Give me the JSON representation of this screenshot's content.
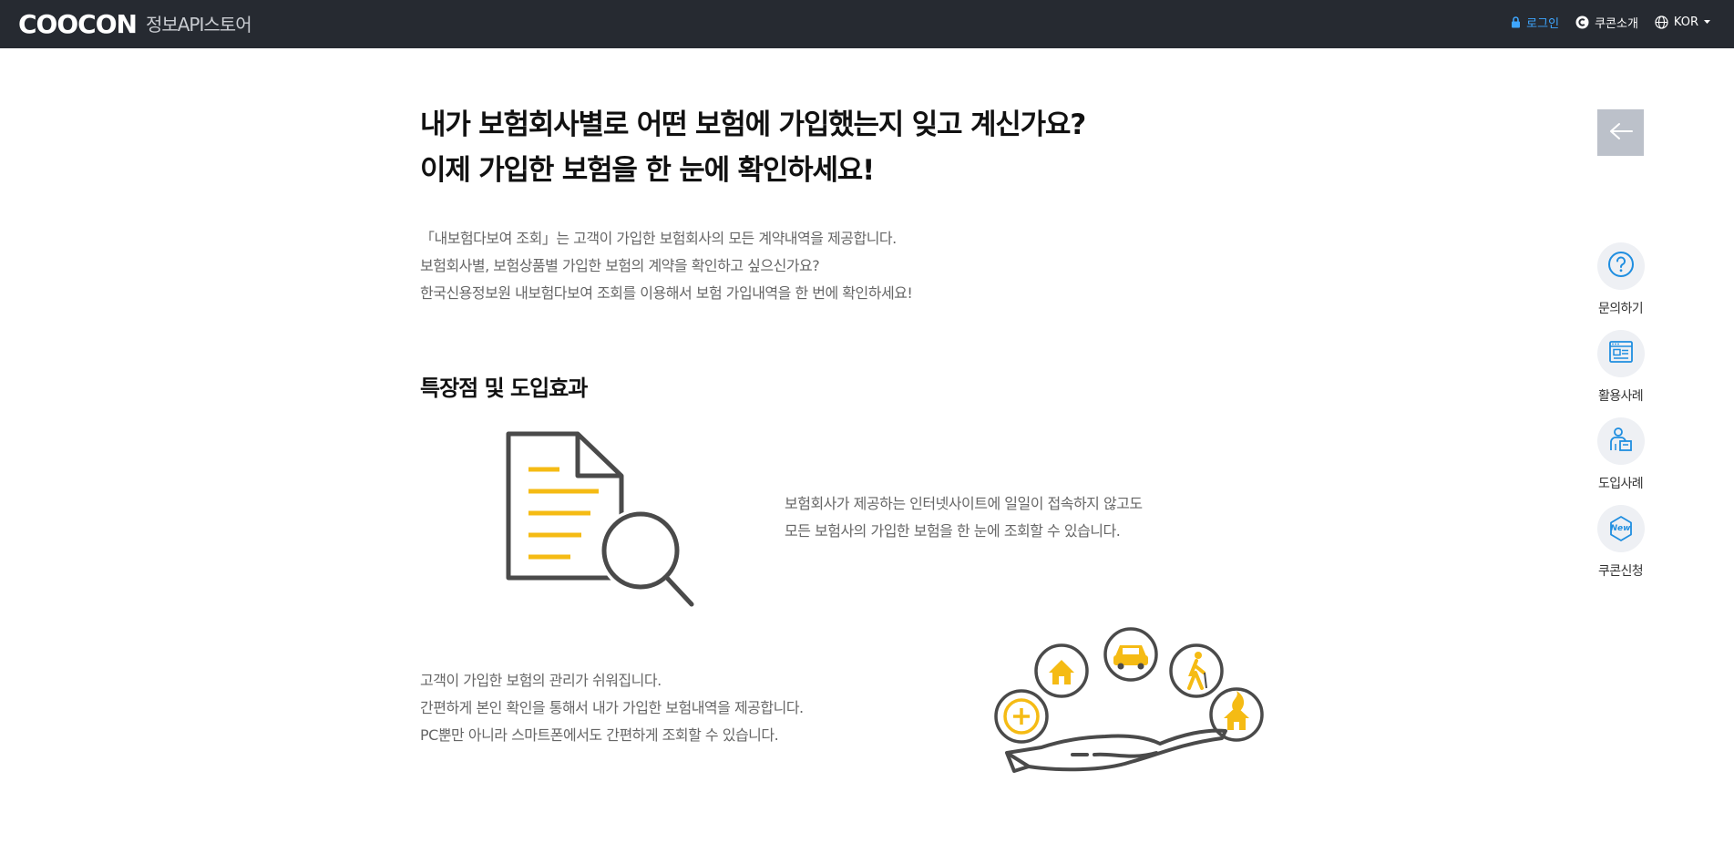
{
  "header": {
    "logo": "COOCON",
    "subtitle": "정보API스토어",
    "nav": {
      "login": "로그인",
      "about": "쿠콘소개",
      "language": "KOR"
    }
  },
  "main": {
    "headline": [
      "내가 보험회사별로 어떤 보험에 가입했는지 잊고 계신가요?",
      "이제 가입한 보험을 한 눈에 확인하세요!"
    ],
    "intro": [
      "「내보험다보여 조회」는 고객이 가입한 보험회사의 모든 계약내역을 제공합니다.",
      "보험회사별, 보험상품별 가입한 보험의 계약을 확인하고 싶으신가요?",
      "한국신용정보원 내보험다보여 조회를 이용해서 보험 가입내역을 한 번에 확인하세요!"
    ],
    "section_title": "특장점 및 도입효과",
    "features": [
      {
        "icon": "document-search-icon",
        "lines": [
          "보험회사가 제공하는 인터넷사이트에 일일이 접속하지 않고도",
          "모든 보험사의 가입한 보험을 한 눈에 조회할 수 있습니다."
        ]
      },
      {
        "icon": "insurance-hand-icon",
        "lines": [
          "고객이 가입한 보험의 관리가 쉬워집니다.",
          "간편하게 본인 확인을 통해서 내가 가입한 보험내역을 제공합니다.",
          "PC뿐만 아니라 스마트폰에서도 간편하게 조회할 수 있습니다."
        ]
      }
    ]
  },
  "rail": {
    "items": [
      {
        "label": "문의하기",
        "icon": "question-icon"
      },
      {
        "label": "활용사례",
        "icon": "browser-window-icon"
      },
      {
        "label": "도입사례",
        "icon": "person-box-icon"
      },
      {
        "label": "쿠콘신청",
        "icon": "new-badge-icon",
        "badge": "New"
      }
    ]
  },
  "colors": {
    "topbar": "#262a31",
    "login": "#3ea6ff",
    "accent_yellow": "#f5bb14",
    "icon_gray": "#444444",
    "rail_blue": "#1f8ee0",
    "back_button": "#bcc1ca"
  }
}
